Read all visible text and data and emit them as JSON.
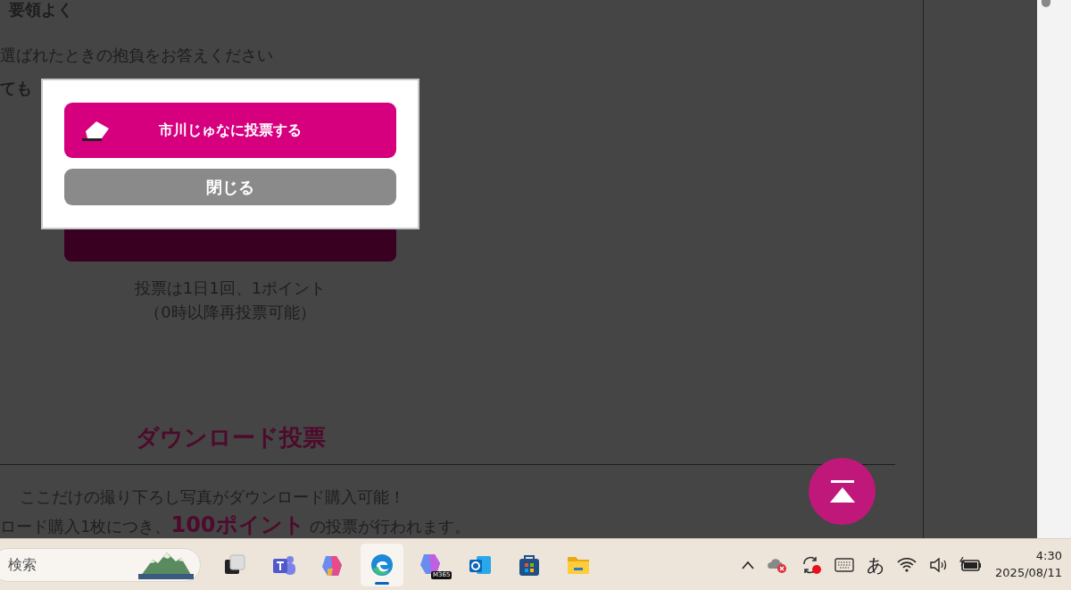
{
  "page": {
    "lines": [
      {
        "text": "要領よく",
        "bold": true
      },
      {
        "text": "選ばれたときの抱負をお答えください",
        "bold": false
      },
      {
        "text": "ても",
        "bold": true
      }
    ],
    "vote_note": [
      "投票は1日1回、1ポイント",
      "（0時以降再投票可能）"
    ],
    "download": {
      "heading": "ダウンロード投票",
      "lines": [
        "ここだけの撮り下ろし写真がダウンロード購入可能！",
        "ロード購入1枚につき、**100ポイント** の投票が行われます。"
      ]
    }
  },
  "modal": {
    "buttons": [
      {
        "kind": "vote",
        "label": "市川じゅなに投票する"
      },
      {
        "kind": "close",
        "label": "閉じる"
      }
    ]
  },
  "taskbar": {
    "search": {
      "placeholder": "検索"
    },
    "apps": [
      {
        "kind": "task-view",
        "selected": false
      },
      {
        "kind": "teams",
        "selected": false
      },
      {
        "kind": "copilot",
        "selected": false
      },
      {
        "kind": "edge",
        "selected": true
      },
      {
        "kind": "m365",
        "selected": false,
        "badge": "M365"
      },
      {
        "kind": "outlook",
        "selected": false
      },
      {
        "kind": "store",
        "selected": false
      },
      {
        "kind": "files",
        "selected": false
      }
    ],
    "tray": {
      "ime": "あ"
    },
    "clock": {
      "time": "4:30",
      "date": "2025/08/11"
    }
  }
}
